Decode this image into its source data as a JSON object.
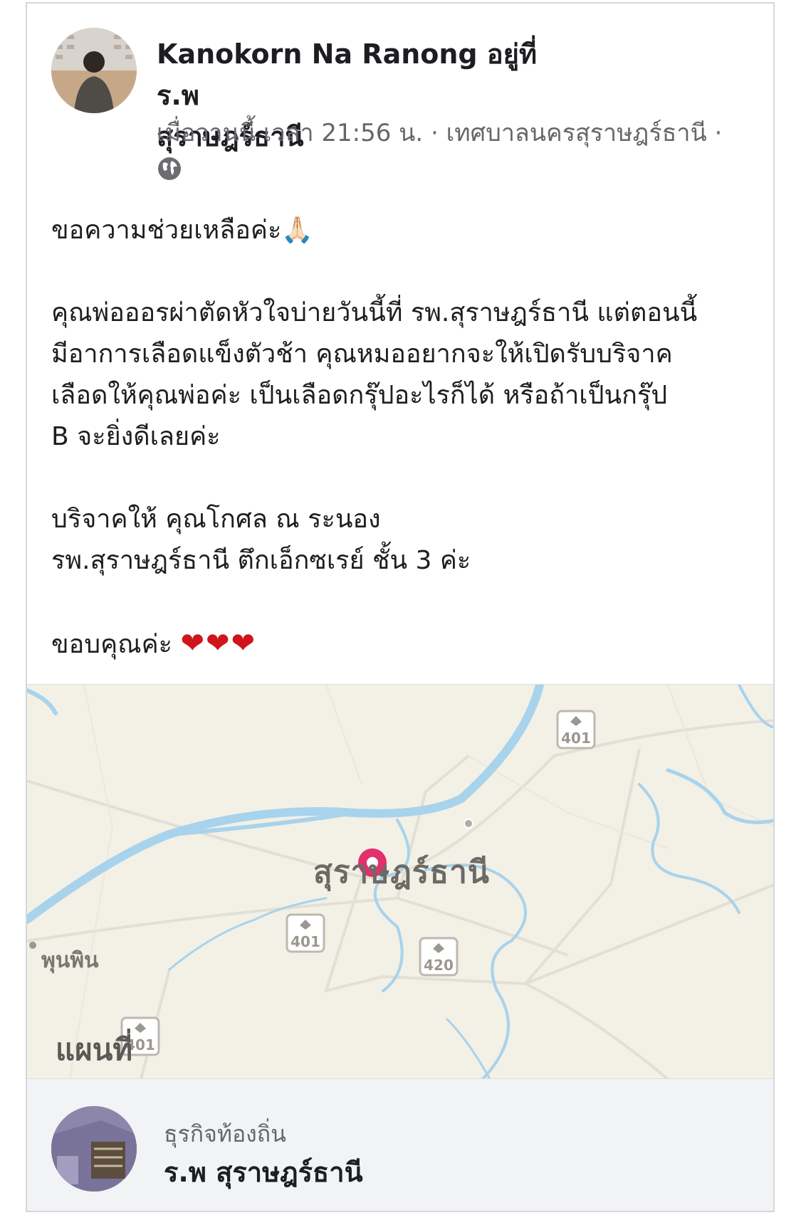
{
  "post": {
    "author": "Kanokorn Na Ranong",
    "location_phrase": "อยู่ที่ ร.พ",
    "location_name": "สุราษฎร์ธานี",
    "meta": "เมื่อวานนี้ เวลา 21:56 น. · เทศบาลนครสุราษฎร์ธานี ·",
    "privacy_icon": "globe-icon",
    "lines": [
      "ขอความช่วยเหลือค่ะ",
      "คุณพ่อออรผ่าตัดหัวใจบ่ายวันนี้ที่ รพ.สุราษฎร์ธานี แต่ตอนนี้",
      "มีอาการเลือดแข็งตัวช้า คุณหมออยากจะให้เปิดรับบริจาค",
      "เลือดให้คุณพ่อค่ะ เป็นเลือดกรุ๊ปอะไรก็ได้ หรือถ้าเป็นกรุ๊ป",
      "B จะยิ่งดีเลยค่ะ",
      "บริจาคให้ คุณโกศล ณ ระนอง",
      "รพ.สุราษฎร์ธานี ตึกเอ็กซเรย์ ชั้น 3 ค่ะ",
      "ขอบคุณค่ะ"
    ],
    "pray_emoji": "🙏🏻",
    "hearts": "❤❤❤"
  },
  "map": {
    "city": "สุราษฎร์ธานี",
    "place": "พุนพิน",
    "brand": "แผนที่",
    "road_shields": [
      "401",
      "401",
      "420",
      "401"
    ],
    "colors": {
      "land": "#f3f0e6",
      "water": "#a7d3ec",
      "road": "#e2ded4",
      "pin": "#e1306c"
    }
  },
  "business": {
    "category": "ธุรกิจท้องถิ่น",
    "name": "ร.พ  สุราษฎร์ธานี"
  }
}
